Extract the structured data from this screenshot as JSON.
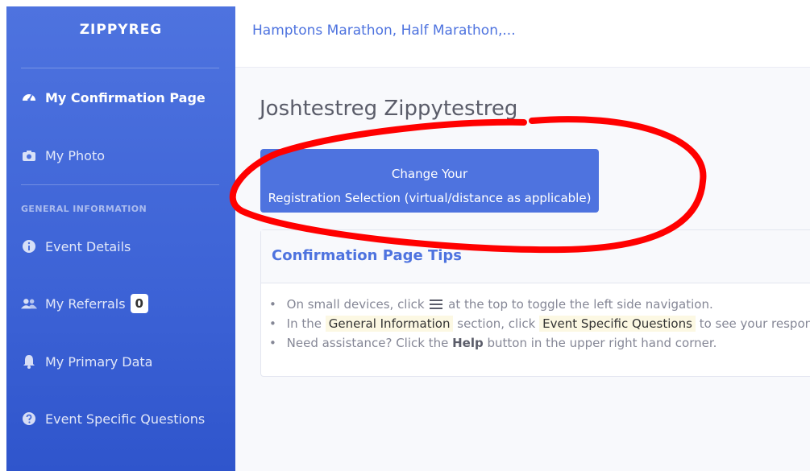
{
  "sidebar": {
    "brand": "ZIPPYREG",
    "items": [
      {
        "label": "My Confirmation Page"
      },
      {
        "label": "My Photo"
      },
      {
        "label": "Event Details"
      },
      {
        "label": "My Referrals",
        "badge": "0"
      },
      {
        "label": "My Primary Data"
      },
      {
        "label": "Event Specific Questions"
      }
    ],
    "heading": "GENERAL INFORMATION"
  },
  "topbar": {
    "event_title": "Hamptons Marathon, Half Marathon,..."
  },
  "main": {
    "page_title": "Joshtestreg Zippytestreg",
    "change_button": {
      "line1": "Change Your",
      "line2": "Registration Selection (virtual/distance as applicable)"
    },
    "tips_card": {
      "title": "Confirmation Page Tips",
      "tip1_pre": "On small devices, click",
      "tip1_post": "at the top to toggle the left side navigation.",
      "tip2_pre": "In the",
      "tip2_hl1": "General Information",
      "tip2_mid": "section, click",
      "tip2_hl2": "Event Specific Questions",
      "tip2_post": "to see your responses t",
      "tip3_pre": "Need assistance? Click the",
      "tip3_bold": "Help",
      "tip3_post": "button in the upper right hand corner."
    }
  },
  "colors": {
    "primary": "#4e73df",
    "annotation": "#ff0000"
  },
  "icons": [
    "dashboard-icon",
    "camera-icon",
    "info-icon",
    "users-icon",
    "bell-icon",
    "question-icon",
    "hamburger-icon"
  ]
}
